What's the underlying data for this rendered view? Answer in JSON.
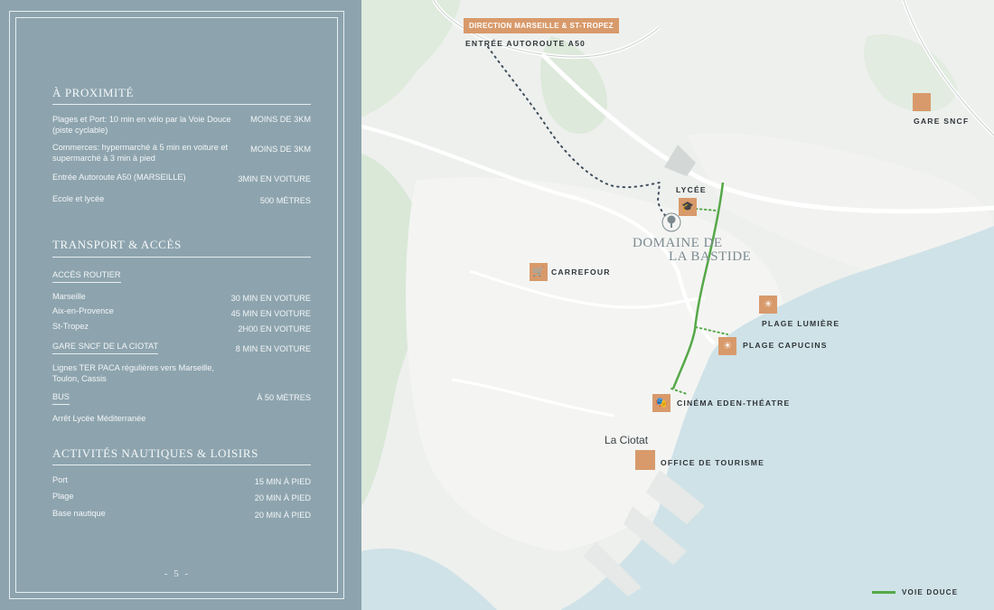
{
  "proximity": {
    "title": "À PROXIMITÉ",
    "rows": [
      {
        "label": "Plages et Port: 10 min en vélo par la Voie Douce (piste cyclable)",
        "value": "MOINS DE 3KM"
      },
      {
        "label": "Commerces: hypermarché à 5 min en voiture et supermarché à 3 min à pied",
        "value": "MOINS DE 3KM"
      },
      {
        "label": "Entrée Autoroute A50 (MARSEILLE)",
        "value": "3MIN EN VOITURE"
      },
      {
        "label": "Ecole et lycée",
        "value": "500 MÈTRES"
      }
    ]
  },
  "transport": {
    "title": "TRANSPORT & ACCÈS",
    "road_heading": "ACCÈS ROUTIER",
    "road_rows": [
      {
        "label": "Marseille",
        "value": "30 MIN EN VOITURE"
      },
      {
        "label": "Aix-en-Provence",
        "value": "45 MIN EN VOITURE"
      },
      {
        "label": "St-Tropez",
        "value": "2H00 EN VOITURE"
      }
    ],
    "train_heading": "GARE SNCF DE LA CIOTAT",
    "train_value": "8 MIN EN VOITURE",
    "train_text": "Lignes TER PACA régulières vers Marseille, Toulon, Cassis",
    "bus_heading": "BUS",
    "bus_value": "À 50 MÈTRES",
    "bus_text": "Arrêt Lycée Méditerranée"
  },
  "leisure": {
    "title": "ACTIVITÉS NAUTIQUES & LOISIRS",
    "rows": [
      {
        "label": "Port",
        "value": "15 MIN À PIED"
      },
      {
        "label": "Plage",
        "value": "20 MIN À PIED"
      },
      {
        "label": "Base nautique",
        "value": "20 MIN À PIED"
      }
    ]
  },
  "page_number": "- 5 -",
  "map": {
    "direction_tag": "DIRECTION MARSEILLE & ST-TROPEZ",
    "highway_label": "ENTRÉE AUTOROUTE A50",
    "town_label": "La Ciotat",
    "logo_line1": "DOMAINE DE",
    "logo_line2": "LA BASTIDE",
    "pois": {
      "gare": {
        "label": "GARE SNCF",
        "icon": "train-station-icon"
      },
      "lycee": {
        "label": "LYCÉE",
        "icon": "graduation-cap-icon",
        "glyph": "🎓"
      },
      "carrefour": {
        "label": "CARREFOUR",
        "icon": "shopping-cart-icon",
        "glyph": "🛒"
      },
      "plage_lumiere": {
        "label": "PLAGE LUMIÈRE",
        "icon": "sun-icon",
        "glyph": "☀"
      },
      "plage_capucins": {
        "label": "PLAGE CAPUCINS",
        "icon": "sun-icon",
        "glyph": "☀"
      },
      "cinema": {
        "label": "CINÉMA EDEN-THÉATRE",
        "icon": "theatre-masks-icon",
        "glyph": "🎭"
      },
      "office": {
        "label": "OFFICE DE TOURISME",
        "icon": "tourism-office-icon"
      }
    },
    "legend_label": "VOIE DOUCE",
    "colors": {
      "panel": "#8da4ae",
      "accent": "#d89a6b",
      "sea": "#cfe2e7",
      "green_route": "#55a848"
    }
  }
}
